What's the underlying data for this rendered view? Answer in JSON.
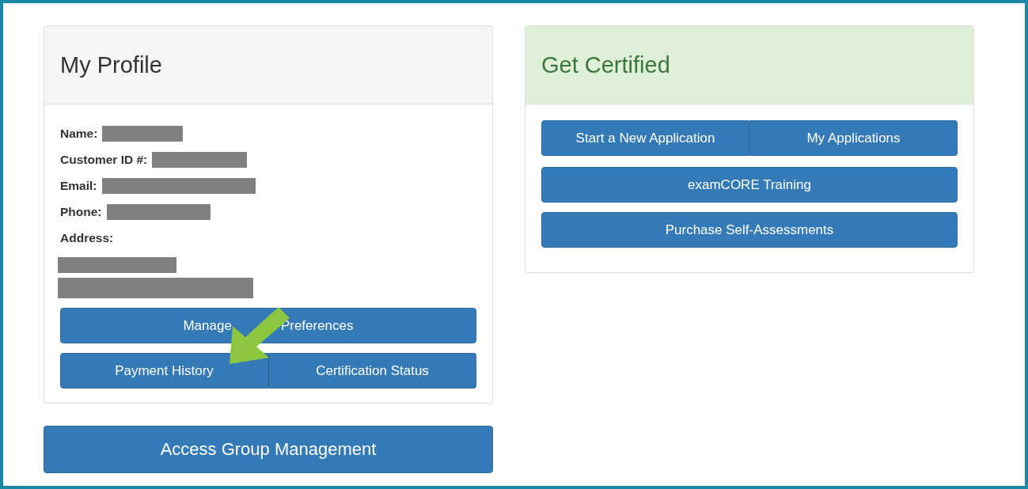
{
  "profile": {
    "title": "My Profile",
    "fields": [
      {
        "label": "Name:"
      },
      {
        "label": "Customer ID #:"
      },
      {
        "label": "Email:"
      },
      {
        "label": "Phone:"
      }
    ],
    "address_label": "Address:",
    "manage_button": [
      "Manage",
      "Preferences"
    ],
    "button_group": [
      "Payment History",
      "Certification Status"
    ]
  },
  "group_button": "Access Group Management",
  "certified": {
    "title": "Get Certified",
    "button_group": [
      "Start a New Application",
      "My Applications"
    ],
    "buttons": [
      "examCORE Training",
      "Purchase Self-Assessments"
    ]
  }
}
